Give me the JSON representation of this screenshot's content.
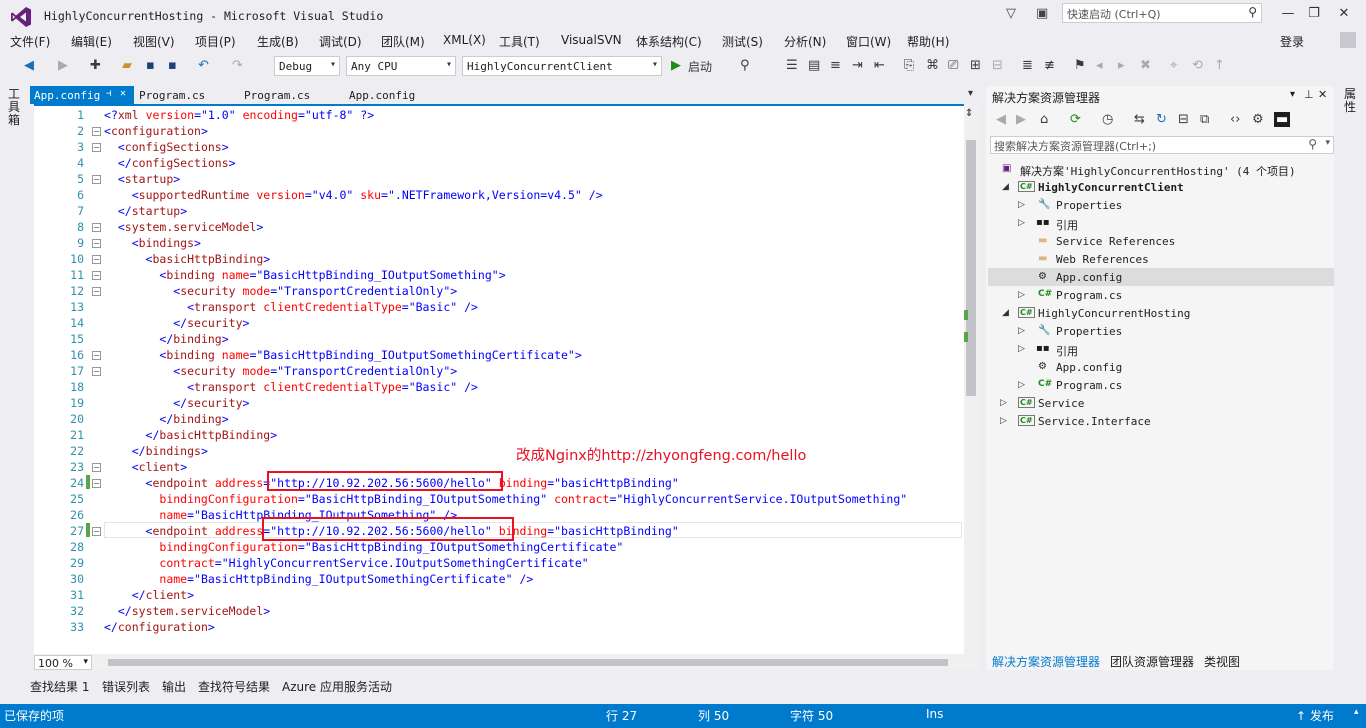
{
  "window": {
    "title": "HighlyConcurrentHosting - Microsoft Visual Studio",
    "quick_launch_placeholder": "快速启动 (Ctrl+Q)"
  },
  "menu": [
    "文件(F)",
    "编辑(E)",
    "视图(V)",
    "项目(P)",
    "生成(B)",
    "调试(D)",
    "团队(M)",
    "XML(X)",
    "工具(T)",
    "VisualSVN",
    "体系结构(C)",
    "测试(S)",
    "分析(N)",
    "窗口(W)",
    "帮助(H)"
  ],
  "login": "登录",
  "toolbar": {
    "config": "Debug",
    "platform": "Any CPU",
    "startup_project": "HighlyConcurrentClient",
    "start_label": "启动"
  },
  "side": {
    "toolbox": "工具箱",
    "properties": "属性"
  },
  "tabs": [
    "App.config",
    "Program.cs",
    "Program.cs",
    "App.config"
  ],
  "code": [
    {
      "n": "1",
      "t": "<?xml version=\"1.0\" encoding=\"utf-8\" ?>"
    },
    {
      "n": "2",
      "t": "<configuration>"
    },
    {
      "n": "3",
      "t": "  <configSections>"
    },
    {
      "n": "4",
      "t": "  </configSections>"
    },
    {
      "n": "5",
      "t": "  <startup>"
    },
    {
      "n": "6",
      "t": "    <supportedRuntime version=\"v4.0\" sku=\".NETFramework,Version=v4.5\" />"
    },
    {
      "n": "7",
      "t": "  </startup>"
    },
    {
      "n": "8",
      "t": "  <system.serviceModel>"
    },
    {
      "n": "9",
      "t": "    <bindings>"
    },
    {
      "n": "10",
      "t": "      <basicHttpBinding>"
    },
    {
      "n": "11",
      "t": "        <binding name=\"BasicHttpBinding_IOutputSomething\">"
    },
    {
      "n": "12",
      "t": "          <security mode=\"TransportCredentialOnly\">"
    },
    {
      "n": "13",
      "t": "            <transport clientCredentialType=\"Basic\" />"
    },
    {
      "n": "14",
      "t": "          </security>"
    },
    {
      "n": "15",
      "t": "        </binding>"
    },
    {
      "n": "16",
      "t": "        <binding name=\"BasicHttpBinding_IOutputSomethingCertificate\">"
    },
    {
      "n": "17",
      "t": "          <security mode=\"TransportCredentialOnly\">"
    },
    {
      "n": "18",
      "t": "            <transport clientCredentialType=\"Basic\" />"
    },
    {
      "n": "19",
      "t": "          </security>"
    },
    {
      "n": "20",
      "t": "        </binding>"
    },
    {
      "n": "21",
      "t": "      </basicHttpBinding>"
    },
    {
      "n": "22",
      "t": "    </bindings>"
    },
    {
      "n": "23",
      "t": "    <client>"
    },
    {
      "n": "24",
      "t": "      <endpoint address=\"http://10.92.202.56:5600/hello\" binding=\"basicHttpBinding\""
    },
    {
      "n": "25",
      "t": "        bindingConfiguration=\"BasicHttpBinding_IOutputSomething\" contract=\"HighlyConcurrentService.IOutputSomething\""
    },
    {
      "n": "26",
      "t": "        name=\"BasicHttpBinding_IOutputSomething\" />"
    },
    {
      "n": "27",
      "t": "      <endpoint address=\"http://10.92.202.56:5600/hello\" binding=\"basicHttpBinding\""
    },
    {
      "n": "28",
      "t": "        bindingConfiguration=\"BasicHttpBinding_IOutputSomethingCertificate\""
    },
    {
      "n": "29",
      "t": "        contract=\"HighlyConcurrentService.IOutputSomethingCertificate\""
    },
    {
      "n": "30",
      "t": "        name=\"BasicHttpBinding_IOutputSomethingCertificate\" />"
    },
    {
      "n": "31",
      "t": "    </client>"
    },
    {
      "n": "32",
      "t": "  </system.serviceModel>"
    },
    {
      "n": "33",
      "t": "</configuration>"
    }
  ],
  "annotation": "改成Nginx的http://zhyongfeng.com/hello",
  "zoom": "100 %",
  "solution_explorer": {
    "title": "解决方案资源管理器",
    "search_placeholder": "搜索解决方案资源管理器(Ctrl+;)",
    "nodes": [
      {
        "label": "解决方案'HighlyConcurrentHosting' (4 个项目)"
      },
      {
        "label": "HighlyConcurrentClient"
      },
      {
        "label": "Properties"
      },
      {
        "label": "引用"
      },
      {
        "label": "Service References"
      },
      {
        "label": "Web References"
      },
      {
        "label": "App.config"
      },
      {
        "label": "Program.cs"
      },
      {
        "label": "HighlyConcurrentHosting"
      },
      {
        "label": "Properties"
      },
      {
        "label": "引用"
      },
      {
        "label": "App.config"
      },
      {
        "label": "Program.cs"
      },
      {
        "label": "Service"
      },
      {
        "label": "Service.Interface"
      }
    ],
    "tabs": [
      "解决方案资源管理器",
      "团队资源管理器",
      "类视图"
    ]
  },
  "bottom_tabs": [
    "查找结果 1",
    "错误列表",
    "输出",
    "查找符号结果",
    "Azure 应用服务活动"
  ],
  "status": {
    "message": "已保存的项",
    "row": "行 27",
    "col": "列 50",
    "char": "字符 50",
    "mode": "Ins",
    "publish": "↑ 发布"
  },
  "colors": {
    "accent": "#007acc",
    "highlight_red": "#e81123"
  }
}
